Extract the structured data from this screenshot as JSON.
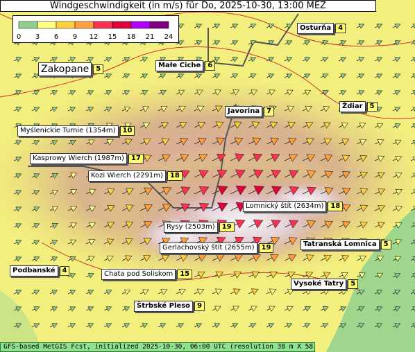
{
  "title": "Windgeschwindigkeit (in m/s) für Do, 2025-10-30, 13:00 MEZ",
  "legend": {
    "ticks": [
      "0",
      "3",
      "6",
      "9",
      "12",
      "15",
      "18",
      "21",
      "24"
    ],
    "colors": [
      "#8fd08f",
      "#ffff80",
      "#ffd040",
      "#ffa040",
      "#ff3050",
      "#e0003a",
      "#b000ff",
      "#800080"
    ]
  },
  "locations": [
    {
      "name": "Osturňa",
      "value": "4",
      "style": "bold"
    },
    {
      "name": "Zakopane",
      "value": "5",
      "style": "big"
    },
    {
      "name": "Małe Ciche",
      "value": "6",
      "style": "bold"
    },
    {
      "name": "Javorina",
      "value": "7",
      "style": "bold"
    },
    {
      "name": "Ždiar",
      "value": "5",
      "style": "bold"
    },
    {
      "name": "Myślenickie Turnie (1354m)",
      "value": "10",
      "style": "normal"
    },
    {
      "name": "Kasprowy Wierch (1987m)",
      "value": "17",
      "style": "normal"
    },
    {
      "name": "Kozi Wierch (2291m)",
      "value": "18",
      "style": "normal"
    },
    {
      "name": "Lomnický štít (2634m)",
      "value": "18",
      "style": "normal"
    },
    {
      "name": "Rysy (2503m)",
      "value": "19",
      "style": "normal"
    },
    {
      "name": "Gerlachovský štít (2655m)",
      "value": "19",
      "style": "normal"
    },
    {
      "name": "Tatranská Lomnica",
      "value": "5",
      "style": "bold"
    },
    {
      "name": "Podbanské",
      "value": "4",
      "style": "bold"
    },
    {
      "name": "Chata pod Soliskom",
      "value": "15",
      "style": "normal"
    },
    {
      "name": "Vysoké Tatry",
      "value": "5",
      "style": "bold"
    },
    {
      "name": "Štrbské Pleso",
      "value": "9",
      "style": "bold"
    }
  ],
  "footer": "GFS-based MetGIS Fcst, initialized 2025-10-30, 06:00 UTC  (resolution 38 m X 58 m)"
}
